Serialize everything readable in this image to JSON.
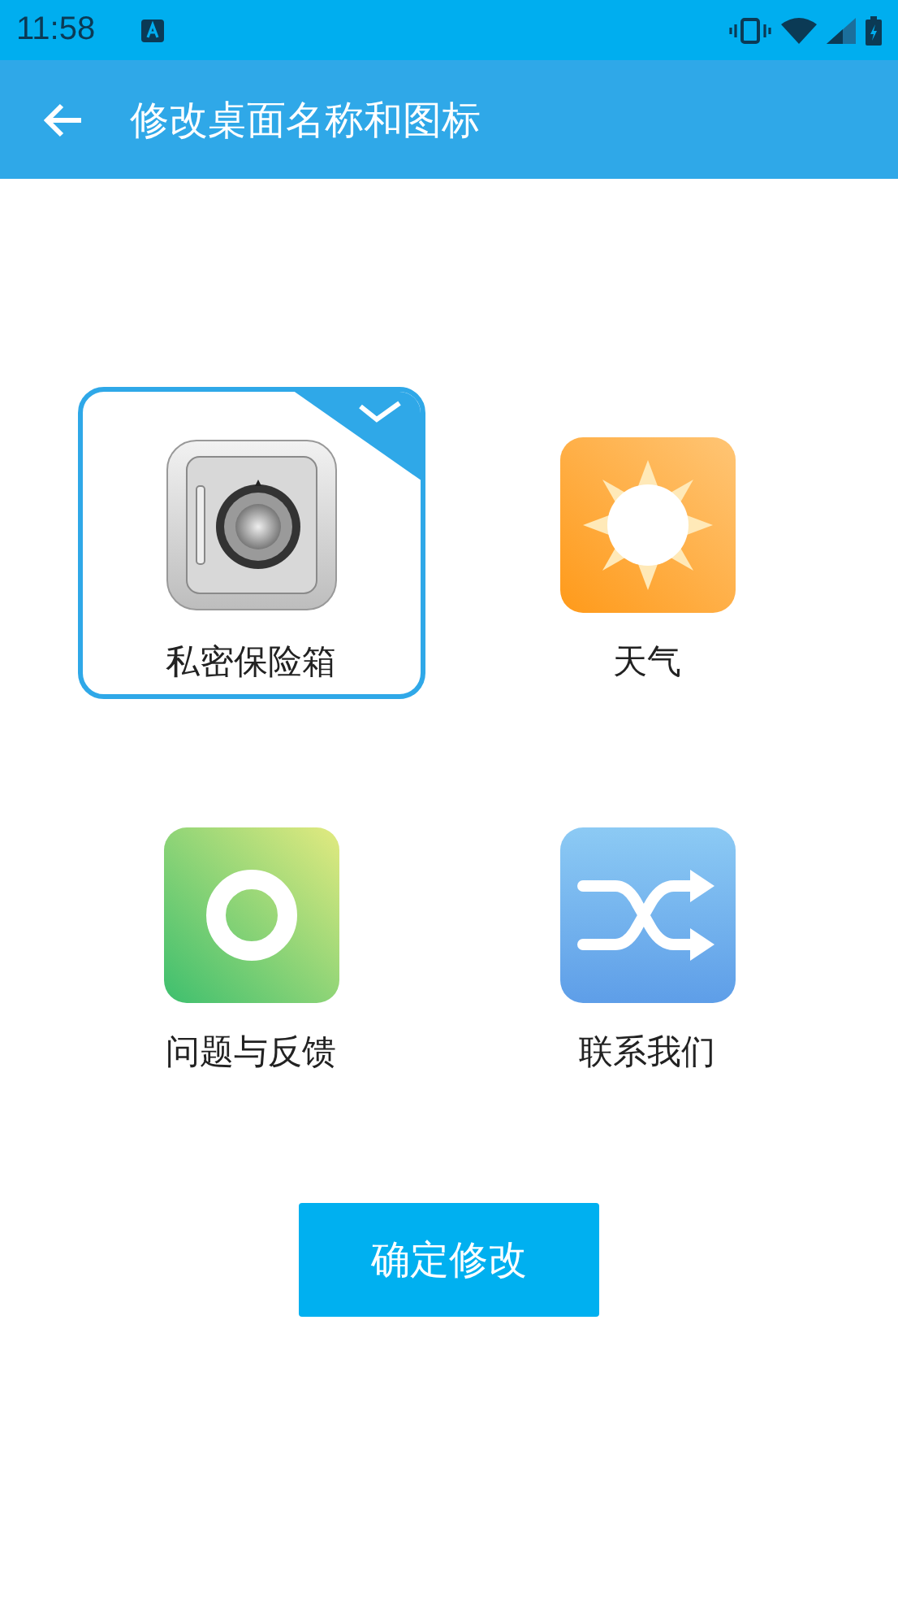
{
  "status_bar": {
    "time": "11:58"
  },
  "app_bar": {
    "title": "修改桌面名称和图标"
  },
  "apps": [
    {
      "label": "私密保险箱",
      "kind": "safe",
      "selected": true
    },
    {
      "label": "天气",
      "kind": "sun",
      "selected": false
    },
    {
      "label": "问题与反馈",
      "kind": "ring",
      "selected": false
    },
    {
      "label": "联系我们",
      "kind": "shuffle",
      "selected": false
    }
  ],
  "confirm_button": "确定修改"
}
